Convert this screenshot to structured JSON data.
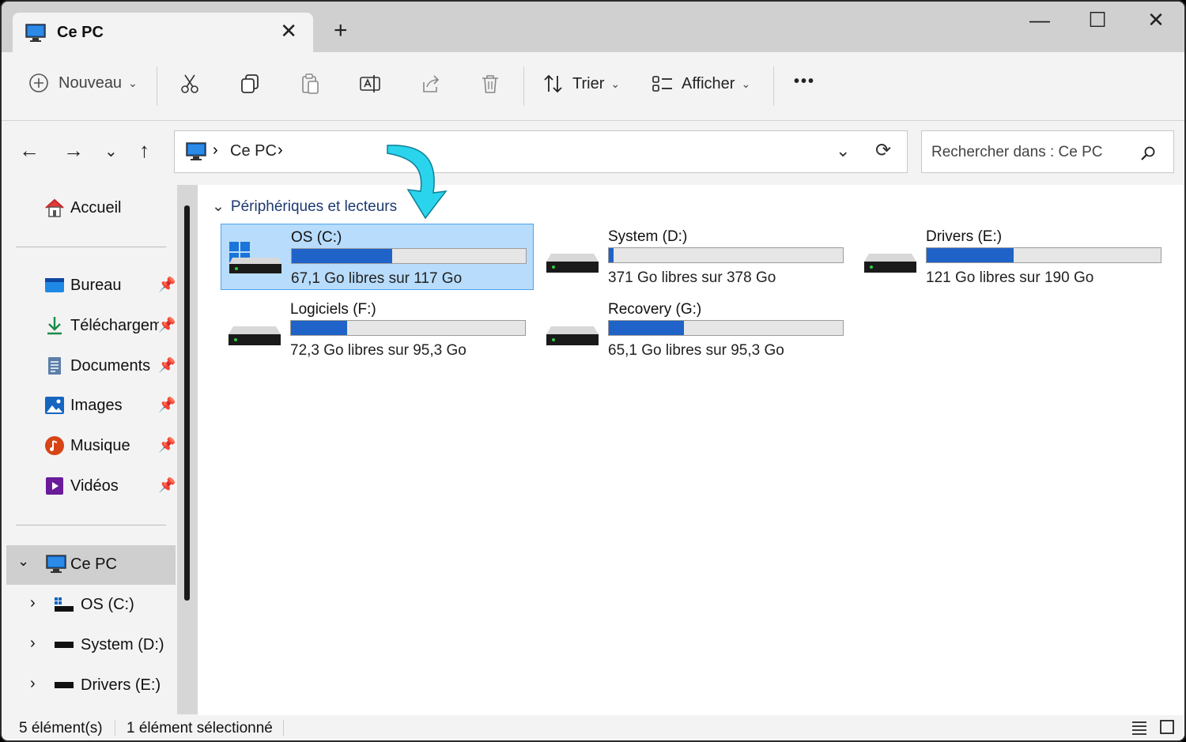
{
  "tab": {
    "title": "Ce PC",
    "close": "✕",
    "new_tab": "+"
  },
  "window_controls": {
    "minimize": "—",
    "maximize": "☐",
    "close": "✕"
  },
  "toolbar": {
    "new_label": "Nouveau",
    "sort_label": "Trier",
    "view_label": "Afficher",
    "more_label": "•••"
  },
  "address": {
    "crumb": "Ce PC",
    "sep": "›"
  },
  "search": {
    "placeholder": "Rechercher dans : Ce PC"
  },
  "sidebar": {
    "home": "Accueil",
    "quick": [
      {
        "label": "Bureau",
        "icon": "desktop-icon"
      },
      {
        "label": "Téléchargements",
        "icon": "download-icon"
      },
      {
        "label": "Documents",
        "icon": "documents-icon"
      },
      {
        "label": "Images",
        "icon": "images-icon"
      },
      {
        "label": "Musique",
        "icon": "music-icon"
      },
      {
        "label": "Vidéos",
        "icon": "videos-icon"
      }
    ],
    "this_pc": "Ce PC",
    "drives": [
      "OS (C:)",
      "System (D:)",
      "Drivers (E:)"
    ]
  },
  "content": {
    "group_title": "Périphériques et lecteurs",
    "drives": [
      {
        "name": "OS (C:)",
        "free_text": "67,1 Go libres sur 117 Go",
        "used_fraction": 0.43,
        "selected": true
      },
      {
        "name": "System (D:)",
        "free_text": "371 Go libres sur 378 Go",
        "used_fraction": 0.02,
        "selected": false
      },
      {
        "name": "Drivers (E:)",
        "free_text": "121 Go libres sur 190 Go",
        "used_fraction": 0.37,
        "selected": false
      },
      {
        "name": "Logiciels (F:)",
        "free_text": "72,3 Go libres sur 95,3 Go",
        "used_fraction": 0.24,
        "selected": false
      },
      {
        "name": "Recovery (G:)",
        "free_text": "65,1 Go libres sur 95,3 Go",
        "used_fraction": 0.32,
        "selected": false
      }
    ]
  },
  "status": {
    "count": "5 élément(s)",
    "selection": "1 élément sélectionné"
  },
  "colors": {
    "accent": "#1f62c8",
    "selection": "#b8dcfb",
    "arrow": "#2ad4ec"
  }
}
